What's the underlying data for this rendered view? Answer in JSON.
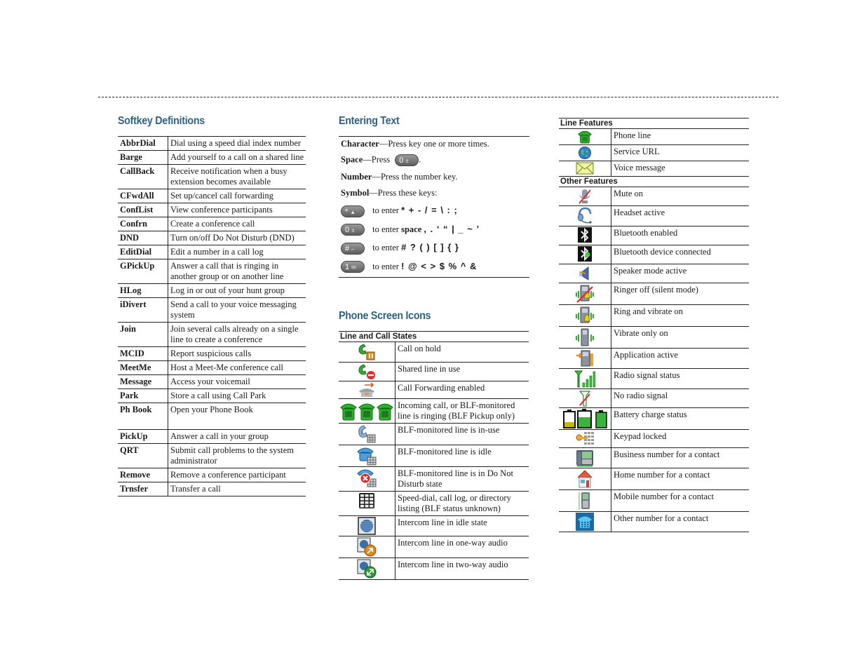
{
  "softkeys": {
    "title": "Softkey Definitions",
    "rows": [
      {
        "key": "AbbrDial",
        "desc": "Dial using a speed dial index number"
      },
      {
        "key": "Barge",
        "desc": "Add yourself to a call on a shared line"
      },
      {
        "key": "CallBack",
        "desc": "Receive notification when a busy extension becomes available"
      },
      {
        "key": "CFwdAll",
        "desc": "Set up/cancel call forwarding"
      },
      {
        "key": "ConfList",
        "desc": "View conference participants"
      },
      {
        "key": "Confrn",
        "desc": "Create a conference call"
      },
      {
        "key": "DND",
        "desc": "Turn on/off Do Not Disturb (DND)"
      },
      {
        "key": "EditDial",
        "desc": "Edit a number in a call log"
      },
      {
        "key": "GPickUp",
        "desc": "Answer a call that is ringing in another group or on another line"
      },
      {
        "key": "HLog",
        "desc": "Log in or out of your hunt group"
      },
      {
        "key": "iDivert",
        "desc": "Send a call to your voice messaging system"
      },
      {
        "key": "Join",
        "desc": "Join several calls already on a single line to create a conference"
      },
      {
        "key": "MCID",
        "desc": "Report suspicious calls"
      },
      {
        "key": "MeetMe",
        "desc": "Host a Meet-Me conference call"
      },
      {
        "key": "Message",
        "desc": "Access your voicemail"
      },
      {
        "key": "Park",
        "desc": "Store a call using Call Park"
      },
      {
        "key": "Ph Book",
        "desc": "Open your Phone Book"
      },
      {
        "key": "PickUp",
        "desc": "Answer a call in your group"
      },
      {
        "key": "QRT",
        "desc": "Submit call problems to the system administrator"
      },
      {
        "key": "Remove",
        "desc": "Remove a conference participant"
      },
      {
        "key": "Trnsfer",
        "desc": "Transfer a call"
      }
    ]
  },
  "entering_text": {
    "title": "Entering Text",
    "character": {
      "term": "Character",
      "text": "—Press key one or more times."
    },
    "space": {
      "term": "Space",
      "text": "—Press",
      "key": "0",
      "after": "."
    },
    "number": {
      "term": "Number",
      "text": "—Press the number key."
    },
    "symbol": {
      "term": "Symbol",
      "text": "—Press these keys:"
    },
    "symbol_keys": [
      {
        "key": "*",
        "prefix": "to enter",
        "bold_word": "",
        "symbols": "* + - / = \\ : ;"
      },
      {
        "key": "0",
        "prefix": "to enter",
        "bold_word": "space",
        "symbols": ", . ‘ “ | _ ~ ’"
      },
      {
        "key": "#",
        "prefix": "to enter",
        "bold_word": "",
        "symbols": "# ? ( ) [ ] { }"
      },
      {
        "key": "1",
        "prefix": "to enter",
        "bold_word": "",
        "symbols": "! @ < > $ % ^ &"
      }
    ]
  },
  "phone_screen_icons": {
    "title": "Phone Screen Icons",
    "line_and_call_states": {
      "title": "Line and Call States",
      "rows": [
        {
          "icon": "call-on-hold-icon",
          "label": "Call on hold"
        },
        {
          "icon": "shared-line-in-use-icon",
          "label": "Shared line in use"
        },
        {
          "icon": "call-forwarding-icon",
          "label": "Call Forwarding enabled"
        },
        {
          "icon": "incoming-call-icon",
          "label": "Incoming call, or BLF-monitored line is ringing (BLF Pickup only)"
        },
        {
          "icon": "blf-in-use-icon",
          "label": "BLF-monitored line is in-use"
        },
        {
          "icon": "blf-idle-icon",
          "label": "BLF-monitored line is idle"
        },
        {
          "icon": "blf-dnd-icon",
          "label": "BLF-monitored line is in Do Not Disturb state"
        },
        {
          "icon": "speed-dial-listing-icon",
          "label": "Speed-dial, call log, or directory listing (BLF status unknown)"
        },
        {
          "icon": "intercom-idle-icon",
          "label": "Intercom line in idle state"
        },
        {
          "icon": "intercom-one-way-icon",
          "label": "Intercom line in one-way audio"
        },
        {
          "icon": "intercom-two-way-icon",
          "label": "Intercom line in two-way audio"
        }
      ]
    },
    "line_features": {
      "title": "Line Features",
      "rows": [
        {
          "icon": "phone-line-icon",
          "label": "Phone line"
        },
        {
          "icon": "service-url-icon",
          "label": "Service URL"
        },
        {
          "icon": "voice-message-icon",
          "label": "Voice message"
        }
      ]
    },
    "other_features": {
      "title": "Other Features",
      "rows": [
        {
          "icon": "mute-icon",
          "label": "Mute on"
        },
        {
          "icon": "headset-icon",
          "label": "Headset active"
        },
        {
          "icon": "bluetooth-enabled-icon",
          "label": "Bluetooth enabled"
        },
        {
          "icon": "bluetooth-connected-icon",
          "label": "Bluetooth device connected"
        },
        {
          "icon": "speaker-icon",
          "label": "Speaker mode active"
        },
        {
          "icon": "ringer-off-icon",
          "label": "Ringer off (silent mode)"
        },
        {
          "icon": "ring-vibrate-icon",
          "label": "Ring and vibrate on"
        },
        {
          "icon": "vibrate-only-icon",
          "label": "Vibrate only on"
        },
        {
          "icon": "application-active-icon",
          "label": "Application active"
        },
        {
          "icon": "radio-signal-icon",
          "label": "Radio signal status"
        },
        {
          "icon": "no-radio-signal-icon",
          "label": "No radio signal"
        },
        {
          "icon": "battery-icon",
          "label": "Battery charge status"
        },
        {
          "icon": "keypad-locked-icon",
          "label": "Keypad locked"
        },
        {
          "icon": "business-number-icon",
          "label": "Business number for a contact"
        },
        {
          "icon": "home-number-icon",
          "label": "Home number for a contact"
        },
        {
          "icon": "mobile-number-icon",
          "label": "Mobile number for a contact"
        },
        {
          "icon": "other-number-icon",
          "label": "Other number for a contact"
        }
      ]
    }
  },
  "colors": {
    "heading": "#2e6288",
    "phone_green": "#2eae2e",
    "rule": "#222222"
  }
}
